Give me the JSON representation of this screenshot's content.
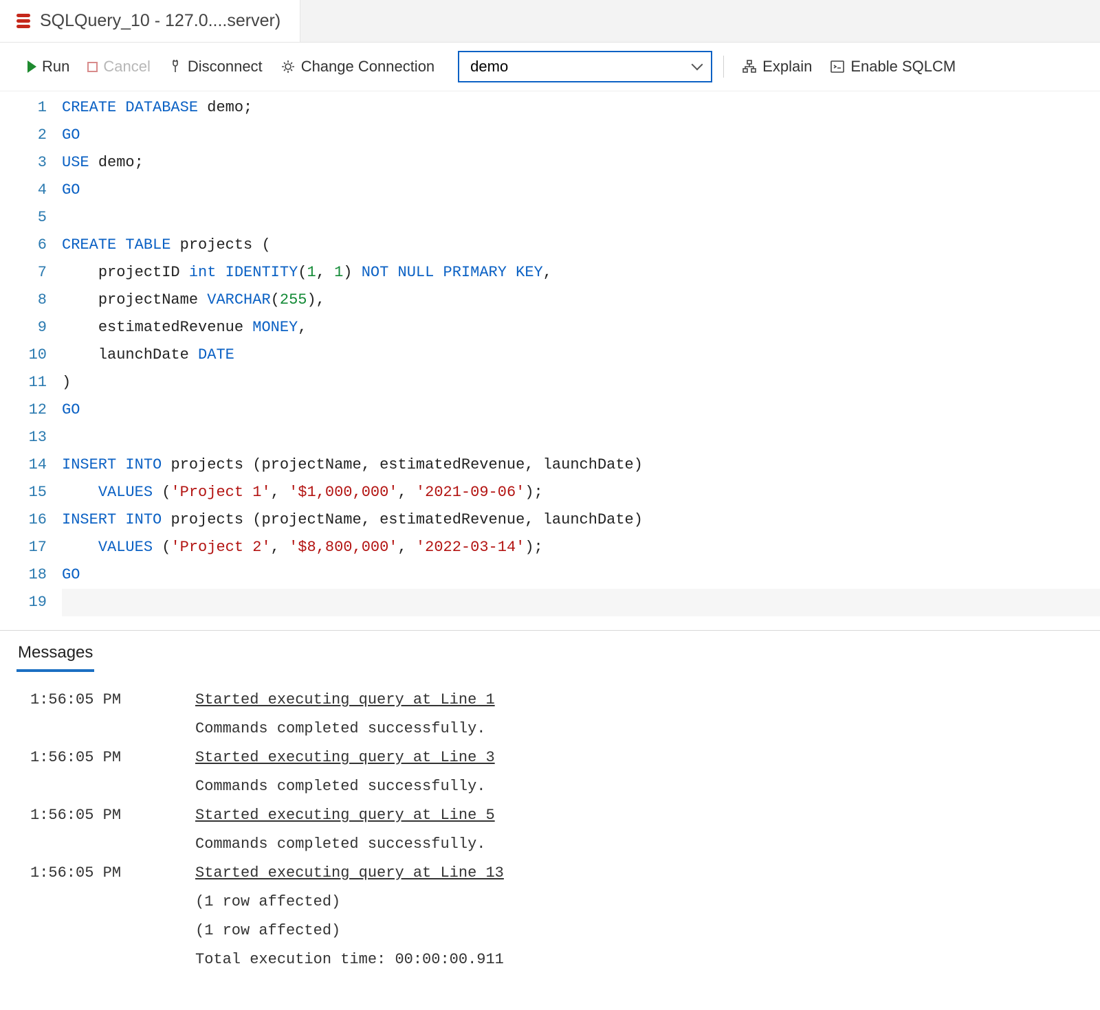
{
  "tab": {
    "title": "SQLQuery_10 - 127.0....server)"
  },
  "toolbar": {
    "run": "Run",
    "cancel": "Cancel",
    "disconnect": "Disconnect",
    "change_conn": "Change Connection",
    "db_value": "demo",
    "explain": "Explain",
    "enable_sqlcmd": "Enable SQLCM"
  },
  "code_lines": [
    {
      "n": "1",
      "tokens": [
        [
          "kw",
          "CREATE"
        ],
        [
          "sp",
          " "
        ],
        [
          "kw",
          "DATABASE"
        ],
        [
          "sp",
          " "
        ],
        [
          "ident",
          "demo;"
        ]
      ]
    },
    {
      "n": "2",
      "tokens": [
        [
          "kw",
          "GO"
        ]
      ]
    },
    {
      "n": "3",
      "tokens": [
        [
          "kw",
          "USE"
        ],
        [
          "sp",
          " "
        ],
        [
          "ident",
          "demo;"
        ]
      ]
    },
    {
      "n": "4",
      "tokens": [
        [
          "kw",
          "GO"
        ]
      ]
    },
    {
      "n": "5",
      "tokens": []
    },
    {
      "n": "6",
      "tokens": [
        [
          "kw",
          "CREATE"
        ],
        [
          "sp",
          " "
        ],
        [
          "kw",
          "TABLE"
        ],
        [
          "sp",
          " "
        ],
        [
          "ident",
          "projects ("
        ]
      ]
    },
    {
      "n": "7",
      "tokens": [
        [
          "sp",
          "    "
        ],
        [
          "ident",
          "projectID "
        ],
        [
          "type",
          "int"
        ],
        [
          "sp",
          " "
        ],
        [
          "kw",
          "IDENTITY"
        ],
        [
          "ident",
          "("
        ],
        [
          "num",
          "1"
        ],
        [
          "ident",
          ", "
        ],
        [
          "num",
          "1"
        ],
        [
          "ident",
          ") "
        ],
        [
          "kw",
          "NOT"
        ],
        [
          "sp",
          " "
        ],
        [
          "kw",
          "NULL"
        ],
        [
          "sp",
          " "
        ],
        [
          "kw",
          "PRIMARY"
        ],
        [
          "sp",
          " "
        ],
        [
          "kw",
          "KEY"
        ],
        [
          "ident",
          ","
        ]
      ]
    },
    {
      "n": "8",
      "tokens": [
        [
          "sp",
          "    "
        ],
        [
          "ident",
          "projectName "
        ],
        [
          "type",
          "VARCHAR"
        ],
        [
          "ident",
          "("
        ],
        [
          "num",
          "255"
        ],
        [
          "ident",
          "),"
        ]
      ]
    },
    {
      "n": "9",
      "tokens": [
        [
          "sp",
          "    "
        ],
        [
          "ident",
          "estimatedRevenue "
        ],
        [
          "type",
          "MONEY"
        ],
        [
          "ident",
          ","
        ]
      ]
    },
    {
      "n": "10",
      "tokens": [
        [
          "sp",
          "    "
        ],
        [
          "ident",
          "launchDate "
        ],
        [
          "type",
          "DATE"
        ]
      ]
    },
    {
      "n": "11",
      "tokens": [
        [
          "ident",
          ")"
        ]
      ]
    },
    {
      "n": "12",
      "tokens": [
        [
          "kw",
          "GO"
        ]
      ]
    },
    {
      "n": "13",
      "tokens": []
    },
    {
      "n": "14",
      "tokens": [
        [
          "kw",
          "INSERT"
        ],
        [
          "sp",
          " "
        ],
        [
          "kw",
          "INTO"
        ],
        [
          "sp",
          " "
        ],
        [
          "ident",
          "projects (projectName, estimatedRevenue, launchDate)"
        ]
      ]
    },
    {
      "n": "15",
      "tokens": [
        [
          "sp",
          "    "
        ],
        [
          "kw",
          "VALUES"
        ],
        [
          "sp",
          " "
        ],
        [
          "ident",
          "("
        ],
        [
          "str",
          "'Project 1'"
        ],
        [
          "ident",
          ", "
        ],
        [
          "str",
          "'$1,000,000'"
        ],
        [
          "ident",
          ", "
        ],
        [
          "str",
          "'2021-09-06'"
        ],
        [
          "ident",
          ");"
        ]
      ]
    },
    {
      "n": "16",
      "tokens": [
        [
          "kw",
          "INSERT"
        ],
        [
          "sp",
          " "
        ],
        [
          "kw",
          "INTO"
        ],
        [
          "sp",
          " "
        ],
        [
          "ident",
          "projects (projectName, estimatedRevenue, launchDate)"
        ]
      ]
    },
    {
      "n": "17",
      "tokens": [
        [
          "sp",
          "    "
        ],
        [
          "kw",
          "VALUES"
        ],
        [
          "sp",
          " "
        ],
        [
          "ident",
          "("
        ],
        [
          "str",
          "'Project 2'"
        ],
        [
          "ident",
          ", "
        ],
        [
          "str",
          "'$8,800,000'"
        ],
        [
          "ident",
          ", "
        ],
        [
          "str",
          "'2022-03-14'"
        ],
        [
          "ident",
          ");"
        ]
      ]
    },
    {
      "n": "18",
      "tokens": [
        [
          "kw",
          "GO"
        ]
      ]
    },
    {
      "n": "19",
      "tokens": [],
      "current": true
    }
  ],
  "results": {
    "tab_label": "Messages",
    "rows": [
      {
        "time": "1:56:05 PM",
        "lines": [
          {
            "u": true,
            "t": "Started executing query at Line 1"
          },
          {
            "t": "Commands completed successfully."
          }
        ]
      },
      {
        "time": "1:56:05 PM",
        "lines": [
          {
            "u": true,
            "t": "Started executing query at Line 3"
          },
          {
            "t": "Commands completed successfully."
          }
        ]
      },
      {
        "time": "1:56:05 PM",
        "lines": [
          {
            "u": true,
            "t": "Started executing query at Line 5"
          },
          {
            "t": "Commands completed successfully."
          }
        ]
      },
      {
        "time": "1:56:05 PM",
        "lines": [
          {
            "u": true,
            "t": "Started executing query at Line 13"
          },
          {
            "t": "(1 row affected)"
          },
          {
            "t": "(1 row affected)"
          },
          {
            "t": "Total execution time: 00:00:00.911"
          }
        ]
      }
    ]
  }
}
